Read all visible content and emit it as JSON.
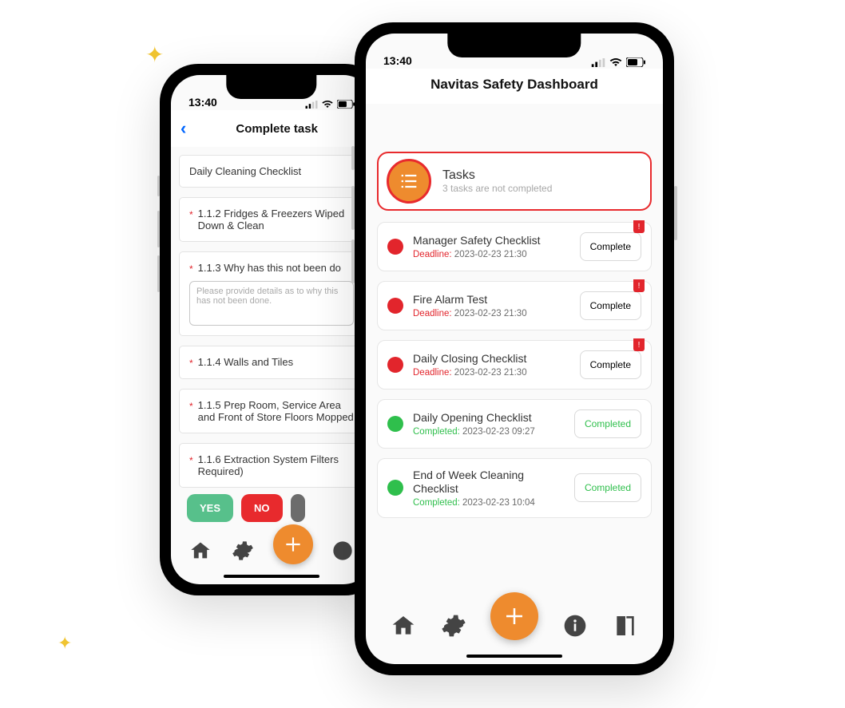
{
  "status": {
    "time": "13:40"
  },
  "phoneA": {
    "header": {
      "title": "Complete task"
    },
    "checklistTitle": "Daily Cleaning Checklist",
    "items": [
      {
        "text": "1.1.2 Fridges & Freezers Wiped Down & Clean"
      },
      {
        "text": "1.1.3 Why has this not been do"
      },
      {
        "text": "1.1.4 Walls and Tiles"
      },
      {
        "text": "1.1.5 Prep Room, Service Area and Front of Store Floors Mopped"
      },
      {
        "text": "1.1.6 Extraction System Filters Required)"
      }
    ],
    "textareaPlaceholder": "Please provide details as to why this has not been done.",
    "buttons": {
      "yes": "YES",
      "no": "NO"
    }
  },
  "phoneB": {
    "header": {
      "title": "Navitas Safety Dashboard"
    },
    "tasksTile": {
      "title": "Tasks",
      "subtitle": "3 tasks are not completed"
    },
    "deadlineLabel": "Deadline:",
    "completedLabel": "Completed:",
    "actionComplete": "Complete",
    "actionCompleted": "Completed",
    "tasks": [
      {
        "title": "Manager Safety Checklist",
        "status": "pending",
        "metaLabel": "Deadline:",
        "metaVal": "2023-02-23  21:30",
        "action": "Complete",
        "flag": true
      },
      {
        "title": "Fire Alarm Test",
        "status": "pending",
        "metaLabel": "Deadline:",
        "metaVal": "2023-02-23  21:30",
        "action": "Complete",
        "flag": true
      },
      {
        "title": "Daily Closing Checklist",
        "status": "pending",
        "metaLabel": "Deadline:",
        "metaVal": "2023-02-23  21:30",
        "action": "Complete",
        "flag": true
      },
      {
        "title": "Daily Opening Checklist",
        "status": "done",
        "metaLabel": "Completed:",
        "metaVal": "2023-02-23  09:27",
        "action": "Completed",
        "flag": false
      },
      {
        "title": "End of Week Cleaning Checklist",
        "status": "done",
        "metaLabel": "Completed:",
        "metaVal": "2023-02-23  10:04",
        "action": "Completed",
        "flag": false
      }
    ]
  }
}
